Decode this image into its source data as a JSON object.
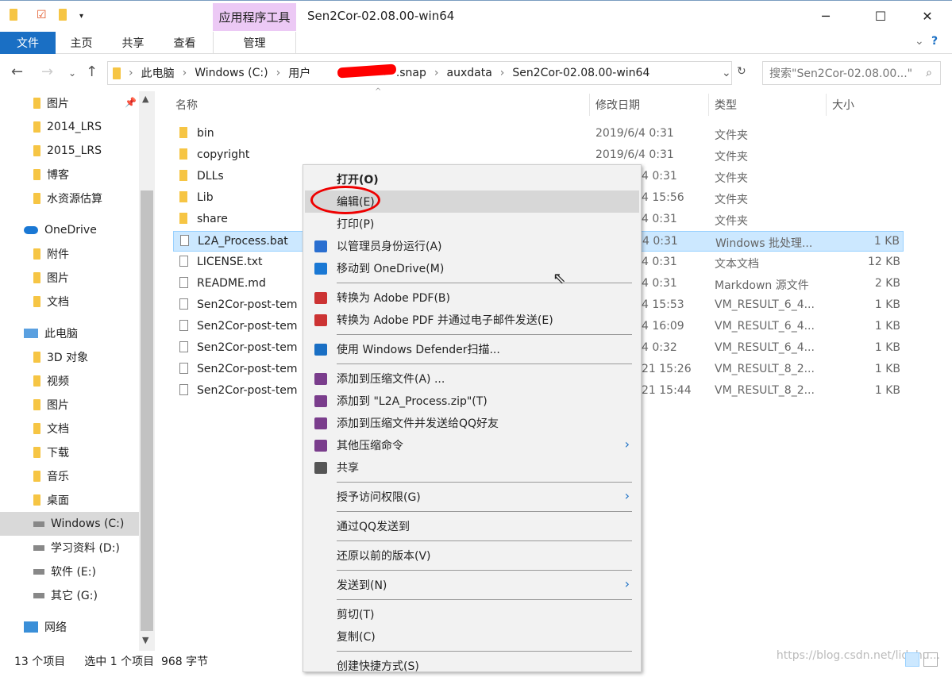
{
  "window": {
    "title": "Sen2Cor-02.08.00-win64",
    "context_tab": "应用程序工具",
    "controls": [
      "minimize",
      "maximize",
      "close"
    ]
  },
  "ribbon": {
    "tabs": [
      "文件",
      "主页",
      "共享",
      "查看",
      "管理"
    ]
  },
  "address": {
    "path": [
      "此电脑",
      "Windows (C:)",
      "用户",
      "",
      ".snap",
      "auxdata",
      "Sen2Cor-02.08.00-win64"
    ],
    "search_placeholder": "搜索\"Sen2Cor-02.08.00...\""
  },
  "sidebar": {
    "items": [
      {
        "label": "图片",
        "icon": "folder-icon",
        "indent": 1
      },
      {
        "label": "2014_LRS",
        "icon": "folder-icon",
        "indent": 1
      },
      {
        "label": "2015_LRS",
        "icon": "folder-icon",
        "indent": 1
      },
      {
        "label": "博客",
        "icon": "folder-icon",
        "indent": 1
      },
      {
        "label": "水资源估算",
        "icon": "folder-icon",
        "indent": 1
      },
      {
        "label": "OneDrive",
        "icon": "cloud-icon",
        "indent": 0
      },
      {
        "label": "附件",
        "icon": "folder-icon",
        "indent": 1
      },
      {
        "label": "图片",
        "icon": "folder-icon",
        "indent": 1
      },
      {
        "label": "文档",
        "icon": "folder-icon",
        "indent": 1
      },
      {
        "label": "此电脑",
        "icon": "computer-icon",
        "indent": 0
      },
      {
        "label": "3D 对象",
        "icon": "folder-icon",
        "indent": 1
      },
      {
        "label": "视频",
        "icon": "folder-icon",
        "indent": 1
      },
      {
        "label": "图片",
        "icon": "folder-icon",
        "indent": 1
      },
      {
        "label": "文档",
        "icon": "folder-icon",
        "indent": 1
      },
      {
        "label": "下载",
        "icon": "folder-icon",
        "indent": 1
      },
      {
        "label": "音乐",
        "icon": "folder-icon",
        "indent": 1
      },
      {
        "label": "桌面",
        "icon": "folder-icon",
        "indent": 1
      },
      {
        "label": "Windows (C:)",
        "icon": "drive-icon",
        "indent": 1,
        "selected": true
      },
      {
        "label": "学习资料 (D:)",
        "icon": "drive-icon",
        "indent": 1
      },
      {
        "label": "软件 (E:)",
        "icon": "drive-icon",
        "indent": 1
      },
      {
        "label": "其它 (G:)",
        "icon": "drive-icon",
        "indent": 1
      },
      {
        "label": "网络",
        "icon": "network-icon",
        "indent": 0
      }
    ]
  },
  "columns": [
    "名称",
    "修改日期",
    "类型",
    "大小"
  ],
  "files": [
    {
      "name": "bin",
      "date": "2019/6/4 0:31",
      "type": "文件夹",
      "size": "",
      "icon": "folder"
    },
    {
      "name": "copyright",
      "date": "2019/6/4 0:31",
      "type": "文件夹",
      "size": "",
      "icon": "folder"
    },
    {
      "name": "DLLs",
      "date": "4 0:31",
      "type": "文件夹",
      "size": "",
      "icon": "folder"
    },
    {
      "name": "Lib",
      "date": "4 15:56",
      "type": "文件夹",
      "size": "",
      "icon": "folder"
    },
    {
      "name": "share",
      "date": "4 0:31",
      "type": "文件夹",
      "size": "",
      "icon": "folder"
    },
    {
      "name": "L2A_Process.bat",
      "date": "4 0:31",
      "type": "Windows 批处理...",
      "size": "1 KB",
      "icon": "bat",
      "selected": true
    },
    {
      "name": "LICENSE.txt",
      "date": "4 0:31",
      "type": "文本文档",
      "size": "12 KB",
      "icon": "file"
    },
    {
      "name": "README.md",
      "date": "4 0:31",
      "type": "Markdown 源文件",
      "size": "2 KB",
      "icon": "md"
    },
    {
      "name": "Sen2Cor-post-tem",
      "date": "4 15:53",
      "type": "VM_RESULT_6_4...",
      "size": "1 KB",
      "icon": "file"
    },
    {
      "name": "Sen2Cor-post-tem",
      "date": "4 16:09",
      "type": "VM_RESULT_6_4...",
      "size": "1 KB",
      "icon": "file"
    },
    {
      "name": "Sen2Cor-post-tem",
      "date": "4 0:32",
      "type": "VM_RESULT_6_4...",
      "size": "1 KB",
      "icon": "file"
    },
    {
      "name": "Sen2Cor-post-tem",
      "date": "21 15:26",
      "type": "VM_RESULT_8_2...",
      "size": "1 KB",
      "icon": "file"
    },
    {
      "name": "Sen2Cor-post-tem",
      "date": "21 15:44",
      "type": "VM_RESULT_8_2...",
      "size": "1 KB",
      "icon": "file"
    }
  ],
  "context_menu": [
    {
      "label": "打开(O)",
      "bold": true
    },
    {
      "label": "编辑(E)",
      "highlighted": true
    },
    {
      "label": "打印(P)"
    },
    {
      "label": "以管理员身份运行(A)",
      "icon": "shield-icon"
    },
    {
      "label": "移动到 OneDrive(M)",
      "icon": "cloud-icon",
      "sep_after": true
    },
    {
      "label": "转换为 Adobe PDF(B)",
      "icon": "pdf-icon"
    },
    {
      "label": "转换为 Adobe PDF 并通过电子邮件发送(E)",
      "icon": "pdf-mail-icon",
      "sep_after": true
    },
    {
      "label": "使用 Windows Defender扫描...",
      "icon": "defender-icon",
      "sep_after": true
    },
    {
      "label": "添加到压缩文件(A) ...",
      "icon": "archive-icon"
    },
    {
      "label": "添加到 \"L2A_Process.zip\"(T)",
      "icon": "archive-icon"
    },
    {
      "label": "添加到压缩文件并发送给QQ好友",
      "icon": "archive-icon"
    },
    {
      "label": "其他压缩命令",
      "icon": "archive-icon",
      "submenu": true
    },
    {
      "label": "共享",
      "icon": "share-icon",
      "sep_after": true
    },
    {
      "label": "授予访问权限(G)",
      "submenu": true,
      "sep_after": true
    },
    {
      "label": "通过QQ发送到",
      "sep_after": true
    },
    {
      "label": "还原以前的版本(V)",
      "sep_after": true
    },
    {
      "label": "发送到(N)",
      "submenu": true,
      "sep_after": true
    },
    {
      "label": "剪切(T)"
    },
    {
      "label": "复制(C)",
      "sep_after": true
    },
    {
      "label": "创建快捷方式(S)"
    }
  ],
  "status": {
    "count": "13 个项目",
    "selection": "选中 1 个项目  968 字节"
  },
  "watermark": "https://blog.csdn.net/lidahu...",
  "colors": {
    "accent": "#1a6fc4",
    "context_tab": "#ecc9f5",
    "selection": "#cce8ff",
    "annotation": "#ee0000"
  }
}
